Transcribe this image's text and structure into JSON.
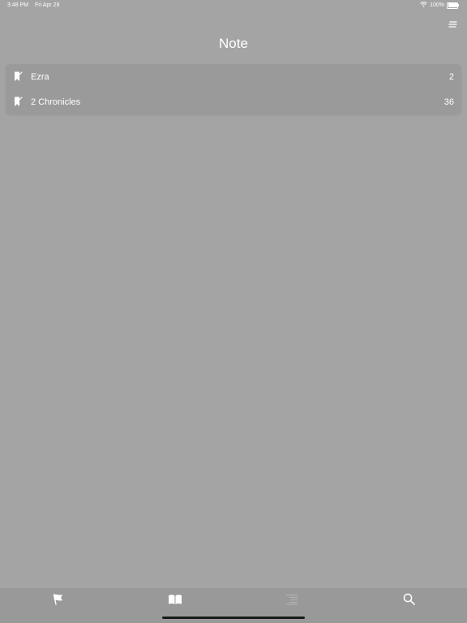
{
  "status_bar": {
    "time": "3:48 PM",
    "date": "Fri Apr 29",
    "battery_text": "100%",
    "wifi_icon": "wifi-icon",
    "battery_icon": "battery-icon"
  },
  "header": {
    "title": "Note",
    "menu_icon": "menu-lines-icon"
  },
  "notes": [
    {
      "label": "Ezra",
      "count": "2",
      "icon": "bookmark-flag-icon"
    },
    {
      "label": "2 Chronicles",
      "count": "36",
      "icon": "bookmark-flag-icon"
    }
  ],
  "tab_bar": {
    "tabs": [
      {
        "icon": "flag-icon",
        "active": true
      },
      {
        "icon": "book-icon",
        "active": true
      },
      {
        "icon": "list-icon",
        "active": false
      },
      {
        "icon": "search-icon",
        "active": true
      }
    ]
  },
  "colors": {
    "background": "#a4a4a4",
    "card": "#9a9a9a",
    "tab_bar": "#999999",
    "text": "#ffffff"
  }
}
